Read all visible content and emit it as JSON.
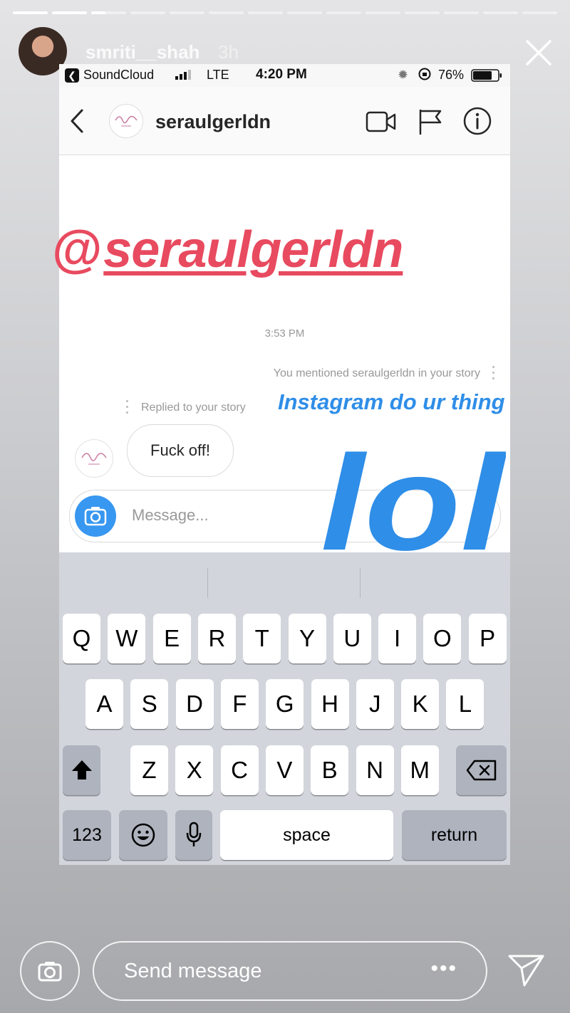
{
  "story": {
    "username": "smriti__shah",
    "time_ago": "3h",
    "progress_segments": 14,
    "active_segment": 3,
    "active_segment_progress": 0.4
  },
  "screenshot": {
    "status_bar": {
      "back_app": "SoundCloud",
      "network": "LTE",
      "time": "4:20 PM",
      "battery": "76%"
    },
    "header": {
      "username": "seraulgerldn",
      "icons": [
        "back-chevron-icon",
        "video-call-icon",
        "flag-icon",
        "info-icon"
      ]
    },
    "messages": {
      "timestamp": "3:53 PM",
      "mention_note": "You mentioned seraulgerldn in your story",
      "replied_note": "Replied to your story",
      "reply_bubble": "Fuck off!"
    },
    "composer": {
      "placeholder": "Message..."
    },
    "keyboard": {
      "row1": [
        "Q",
        "W",
        "E",
        "R",
        "T",
        "Y",
        "U",
        "I",
        "O",
        "P"
      ],
      "row2": [
        "A",
        "S",
        "D",
        "F",
        "G",
        "H",
        "J",
        "K",
        "L"
      ],
      "row3": [
        "Z",
        "X",
        "C",
        "V",
        "B",
        "N",
        "M"
      ],
      "numbers_label": "123",
      "space_label": "space",
      "return_label": "return"
    }
  },
  "stickers": {
    "mention_at": "@",
    "mention_name": "seraulgerldn",
    "text": "Instagram do ur thing",
    "lol": "lol"
  },
  "reply_bar": {
    "placeholder": "Send message"
  },
  "colors": {
    "mention_sticker": "#e84a5f",
    "text_sticker": "#2f8ee8",
    "camera_button": "#3897f0"
  }
}
